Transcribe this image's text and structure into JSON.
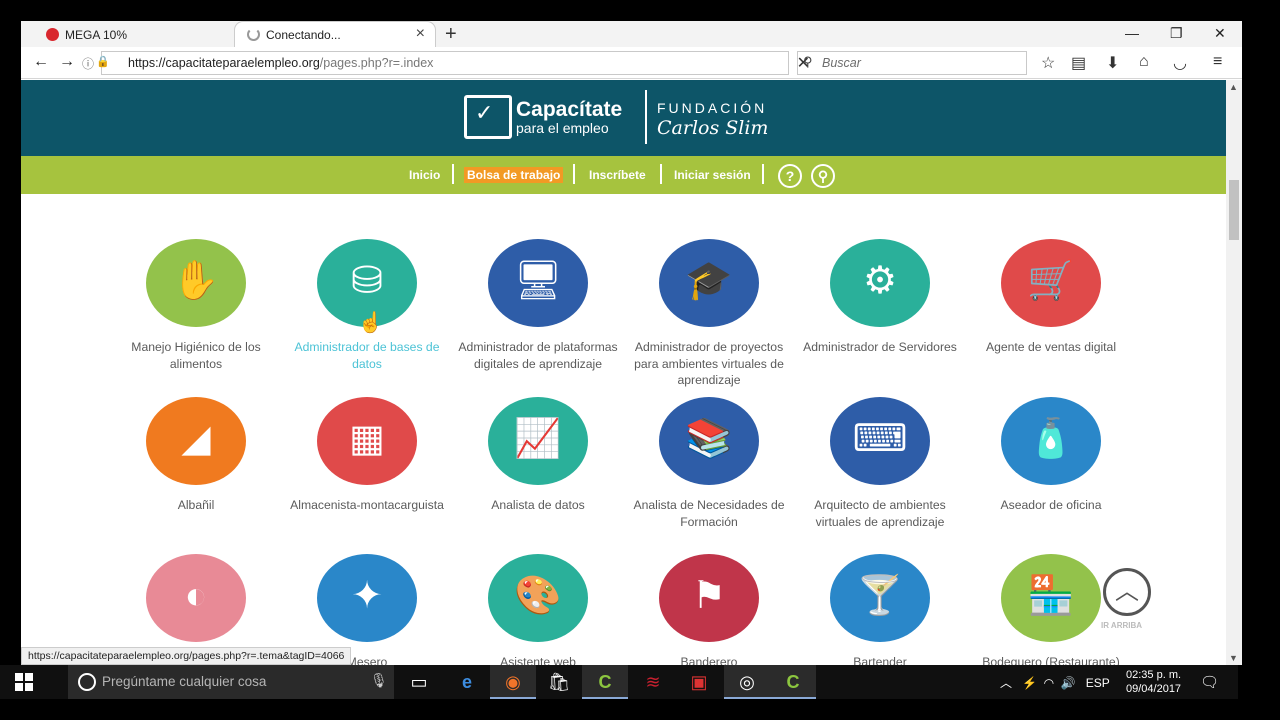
{
  "browser": {
    "tabs": [
      {
        "label": "MEGA 10%",
        "icon": "mega-icon",
        "color": "#d9272e"
      },
      {
        "label": "Conectando...",
        "icon": "loading-spinner-icon"
      }
    ],
    "url_host": "https://capacitateparaelempleo.org",
    "url_path": "/pages.php?r=.index",
    "search_placeholder": "Buscar"
  },
  "site": {
    "logo_title": "Capacítate",
    "logo_sub": "para el empleo",
    "foundation_top": "FUNDACIÓN",
    "foundation_bottom": "Carlos Slim",
    "menu": [
      "Inicio",
      "Bolsa de trabajo",
      "Inscríbete",
      "Iniciar sesión"
    ],
    "colors": {
      "header": "#0d5568",
      "menu": "#a6c33e",
      "menu_active": "#f29a24"
    }
  },
  "courses": [
    {
      "label": "Manejo Higiénico de los alimentos",
      "color": "#93c24b",
      "icon": "hand-washing-icon"
    },
    {
      "label": "Administrador de bases de datos",
      "color": "#2ab09a",
      "icon": "database-icon"
    },
    {
      "label": "Administrador de plataformas digitales de aprendizaje",
      "color": "#2e5da8",
      "icon": "admin-monitor-icon"
    },
    {
      "label": "Administrador de proyectos para ambientes virtuales de aprendizaje",
      "color": "#2e5da8",
      "icon": "graduation-monitor-icon"
    },
    {
      "label": "Administrador de Servidores",
      "color": "#2ab09a",
      "icon": "servers-icon"
    },
    {
      "label": "Agente de ventas digital",
      "color": "#e04a4a",
      "icon": "shopping-cart-icon"
    },
    {
      "label": "Albañil",
      "color": "#f07a1f",
      "icon": "trowel-icon"
    },
    {
      "label": "Almacenista-montacarguista",
      "color": "#e04a4a",
      "icon": "warehouse-icon"
    },
    {
      "label": "Analista de datos",
      "color": "#2ab09a",
      "icon": "chart-magnifier-icon"
    },
    {
      "label": "Analista de Necesidades de Formación",
      "color": "#2e5da8",
      "icon": "books-magnifier-icon"
    },
    {
      "label": "Arquitecto de ambientes virtuales de aprendizaje",
      "color": "#2e5da8",
      "icon": "binary-monitor-icon"
    },
    {
      "label": "Aseador de oficina",
      "color": "#2a87c9",
      "icon": "spray-bottle-icon"
    },
    {
      "label": "",
      "color": "#e88a96",
      "icon": "makeup-compact-icon"
    },
    {
      "label": "Mesero",
      "color": "#2a87c9",
      "icon": "waiter-icon"
    },
    {
      "label": "Asistente web",
      "color": "#2ab09a",
      "icon": "web-palette-icon"
    },
    {
      "label": "Banderero",
      "color": "#c0354a",
      "icon": "road-flag-icon"
    },
    {
      "label": "Bartender",
      "color": "#2a87c9",
      "icon": "cocktail-icon"
    },
    {
      "label": "Bodeguero (Restaurante)",
      "color": "#93c24b",
      "icon": "storefront-icon"
    }
  ],
  "ir_arriba": "IR ARRIBA",
  "status_url": "https://capacitateparaelempleo.org/pages.php?r=.tema&tagID=4066",
  "taskbar": {
    "search_placeholder": "Pregúntame cualquier cosa",
    "language": "ESP",
    "time": "02:35 p. m.",
    "date": "09/04/2017"
  }
}
